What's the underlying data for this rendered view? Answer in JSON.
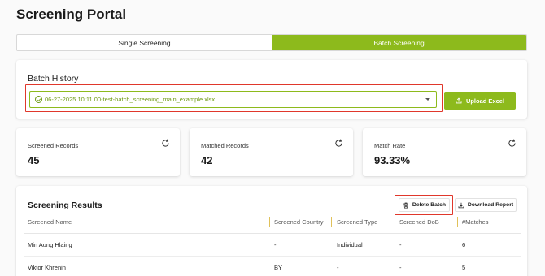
{
  "page_title": "Screening Portal",
  "tabs": [
    {
      "label": "Single Screening",
      "active": false
    },
    {
      "label": "Batch Screening",
      "active": true
    }
  ],
  "batch_history": {
    "title": "Batch History",
    "selected_batch": "06-27-2025 10:11  00-test-batch_screening_main_example.xlsx",
    "upload_label": "Upload Excel"
  },
  "stats": [
    {
      "label": "Screened Records",
      "value": "45"
    },
    {
      "label": "Matched Records",
      "value": "42"
    },
    {
      "label": "Match Rate",
      "value": "93.33%"
    }
  ],
  "results": {
    "title": "Screening Results",
    "delete_label": "Delete Batch",
    "download_label": "Download Report",
    "columns": [
      "Screened Name",
      "Screened Country",
      "Screened Type",
      "Screened DoB",
      "#Matches"
    ],
    "rows": [
      [
        "Min Aung Hlaing",
        "-",
        "Individual",
        "-",
        "6"
      ],
      [
        "Viktor Khrenin",
        "BY",
        "-",
        "-",
        "5"
      ]
    ]
  },
  "colors": {
    "accent": "#8dba1c",
    "highlight": "#e0372b"
  },
  "icons": [
    "check-circle-icon",
    "chevron-down-icon",
    "upload-icon",
    "refresh-icon",
    "trash-icon",
    "download-icon"
  ]
}
